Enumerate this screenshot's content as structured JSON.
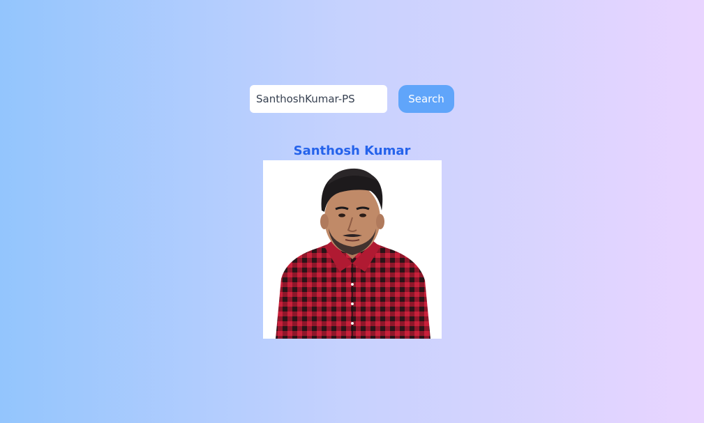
{
  "search": {
    "value": "SanthoshKumar-PS",
    "button_label": "Search"
  },
  "profile": {
    "name": "Santhosh Kumar"
  },
  "colors": {
    "accent": "#2563eb",
    "button": "#60a5fa",
    "shirt_red": "#c8203a",
    "shirt_dark": "#2a1418"
  }
}
